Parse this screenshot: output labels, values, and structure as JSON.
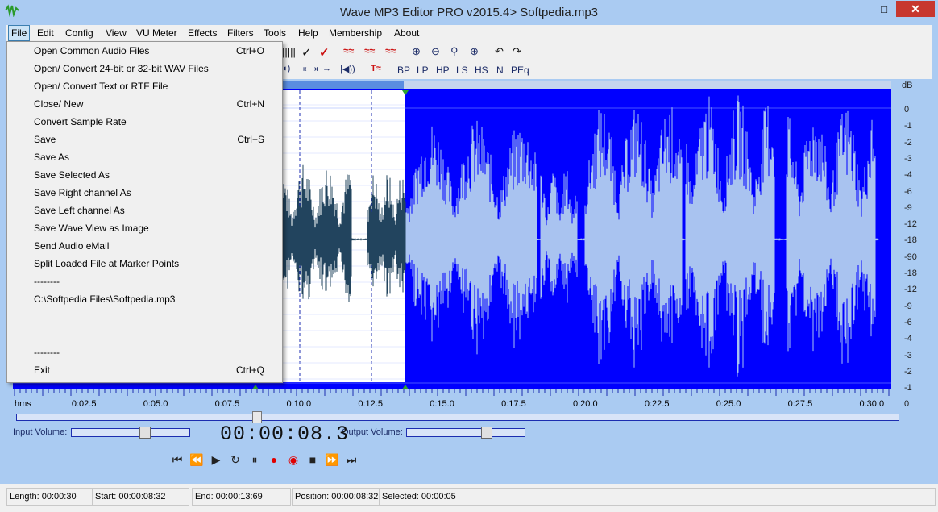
{
  "window": {
    "title": "Wave MP3 Editor PRO v2015.4> Softpedia.mp3",
    "minimize": "—",
    "maximize": "□",
    "close": "✕"
  },
  "menu": [
    "File",
    "Edit",
    "Config",
    "View",
    "VU Meter",
    "Effects",
    "Filters",
    "Tools",
    "Help",
    "Membership",
    "About"
  ],
  "toolbar": {
    "filters": [
      "BP",
      "LP",
      "HP",
      "LS",
      "HS",
      "N",
      "PEq"
    ]
  },
  "file_menu": {
    "items": [
      {
        "label": "Open Common Audio Files",
        "shortcut": "Ctrl+O"
      },
      {
        "label": "Open/ Convert 24-bit or 32-bit WAV Files",
        "shortcut": ""
      },
      {
        "label": "Open/ Convert  Text or RTF File",
        "shortcut": ""
      },
      {
        "label": "Close/ New",
        "shortcut": "Ctrl+N"
      },
      {
        "label": "Convert Sample Rate",
        "shortcut": ""
      },
      {
        "label": "Save",
        "shortcut": "Ctrl+S"
      },
      {
        "label": "Save As",
        "shortcut": ""
      },
      {
        "label": "Save Selected As",
        "shortcut": ""
      },
      {
        "label": "Save Right channel As",
        "shortcut": ""
      },
      {
        "label": "Save Left channel As",
        "shortcut": ""
      },
      {
        "label": "Save Wave View as Image",
        "shortcut": ""
      },
      {
        "label": "Send Audio eMail",
        "shortcut": ""
      },
      {
        "label": "Split Loaded File at Marker Points",
        "shortcut": ""
      },
      {
        "label": "--------",
        "shortcut": ""
      },
      {
        "label": "C:\\Softpedia Files\\Softpedia.mp3",
        "shortcut": ""
      },
      {
        "label": "",
        "shortcut": ""
      },
      {
        "label": "",
        "shortcut": ""
      },
      {
        "label": "--------",
        "shortcut": ""
      },
      {
        "label": "Exit",
        "shortcut": "Ctrl+Q"
      }
    ]
  },
  "db_scale": {
    "header": "dB",
    "labels": [
      "0",
      "-1",
      "-2",
      "-3",
      "-4",
      "-6",
      "-9",
      "-12",
      "-18",
      "-90",
      "-18",
      "-12",
      "-9",
      "-6",
      "-4",
      "-3",
      "-2",
      "-1",
      "0"
    ]
  },
  "timeline": {
    "unit": "hms",
    "ticks": [
      "0:02.5",
      "0:05.0",
      "0:07.5",
      "0:10.0",
      "0:12.5",
      "0:15.0",
      "0:17.5",
      "0:20.0",
      "0:22.5",
      "0:25.0",
      "0:27.5",
      "0:30.0"
    ]
  },
  "volume": {
    "input_label": "Input Volume:",
    "output_label": "Output Volume:",
    "input_level": 0.62,
    "output_level": 0.68
  },
  "timer": "00:00:08.3",
  "status": {
    "length": "Length: 00:00:30",
    "start": "Start: 00:00:08:32",
    "end": "End: 00:00:13:69",
    "position": "Position: 00:00:08:32",
    "selected": "Selected: 00:00:05"
  },
  "colors": {
    "wave_bg": "#0000ff",
    "wave_fg": "#a9c3f0",
    "selection_bg": "#ffffff",
    "selection_wave": "#22445e",
    "window_bg": "#aacbf2"
  }
}
